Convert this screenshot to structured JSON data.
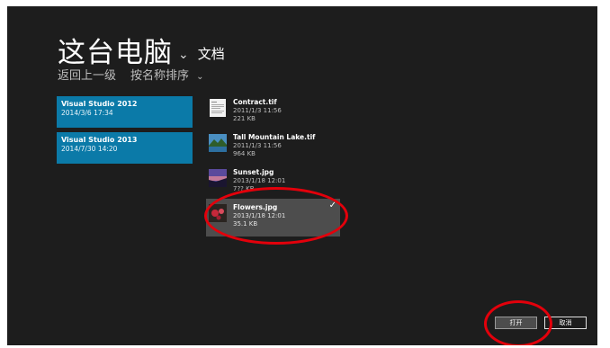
{
  "header": {
    "title": "这台电脑",
    "chevron": "⌄",
    "subfolder": "文档"
  },
  "nav": {
    "back": "返回上一级",
    "sort": "按名称排序",
    "sort_chevron": "⌄"
  },
  "folders": [
    {
      "name": "Visual Studio 2012",
      "date": "2014/3/6 17:34"
    },
    {
      "name": "Visual Studio 2013",
      "date": "2014/7/30 14:20"
    }
  ],
  "files": [
    {
      "name": "Contract.tif",
      "date": "2011/1/3 11:56",
      "size": "221 KB",
      "selected": false
    },
    {
      "name": "Tall Mountain Lake.tif",
      "date": "2011/1/3 11:56",
      "size": "964 KB",
      "selected": false
    },
    {
      "name": "Sunset.jpg",
      "date": "2013/1/18 12:01",
      "size": "7?? KB",
      "selected": false
    },
    {
      "name": "Flowers.jpg",
      "date": "2013/1/18 12:01",
      "size": "35.1 KB",
      "selected": true
    }
  ],
  "selected_check": "✓",
  "buttons": {
    "open": "打开",
    "cancel": "取消"
  },
  "colors": {
    "background": "#1d1d1d",
    "folder_tile": "#0b7aa8",
    "selected_item": "#4d4d4d",
    "annotation": "#e3000b"
  },
  "icons": [
    "document-thumbnail-icon",
    "mountain-lake-thumbnail-icon",
    "sunset-thumbnail-icon",
    "flowers-thumbnail-icon",
    "checkmark-icon"
  ]
}
